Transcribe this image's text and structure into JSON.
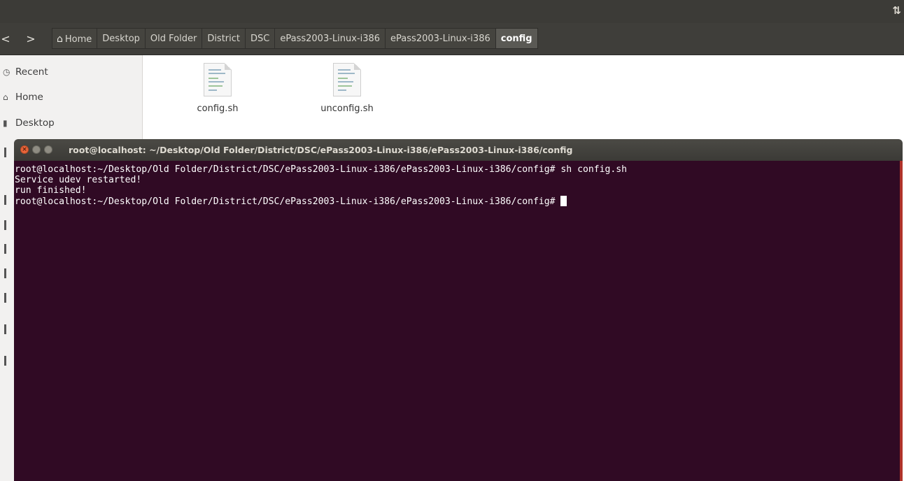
{
  "topbar": {
    "tray_glyph": "⇅"
  },
  "toolbar": {
    "back_glyph": "<",
    "forward_glyph": ">",
    "breadcrumbs": [
      "Home",
      "Desktop",
      "Old Folder",
      "District",
      "DSC",
      "ePass2003-Linux-i386",
      "ePass2003-Linux-i386",
      "config"
    ]
  },
  "sidebar": {
    "items": [
      {
        "label": "Recent",
        "icon": "clock-icon"
      },
      {
        "label": "Home",
        "icon": "home-icon"
      },
      {
        "label": "Desktop",
        "icon": "desktop-icon"
      }
    ]
  },
  "files": [
    {
      "name": "config.sh",
      "icon": "script-file-icon"
    },
    {
      "name": "unconfig.sh",
      "icon": "script-file-icon"
    }
  ],
  "terminal": {
    "title": "root@localhost: ~/Desktop/Old Folder/District/DSC/ePass2003-Linux-i386/ePass2003-Linux-i386/config",
    "lines": [
      "root@localhost:~/Desktop/Old Folder/District/DSC/ePass2003-Linux-i386/ePass2003-Linux-i386/config# sh config.sh",
      "Service udev restarted!",
      "run finished!",
      "root@localhost:~/Desktop/Old Folder/District/DSC/ePass2003-Linux-i386/ePass2003-Linux-i386/config# "
    ],
    "colors": {
      "background": "#300a24",
      "text": "#ffffff"
    }
  }
}
